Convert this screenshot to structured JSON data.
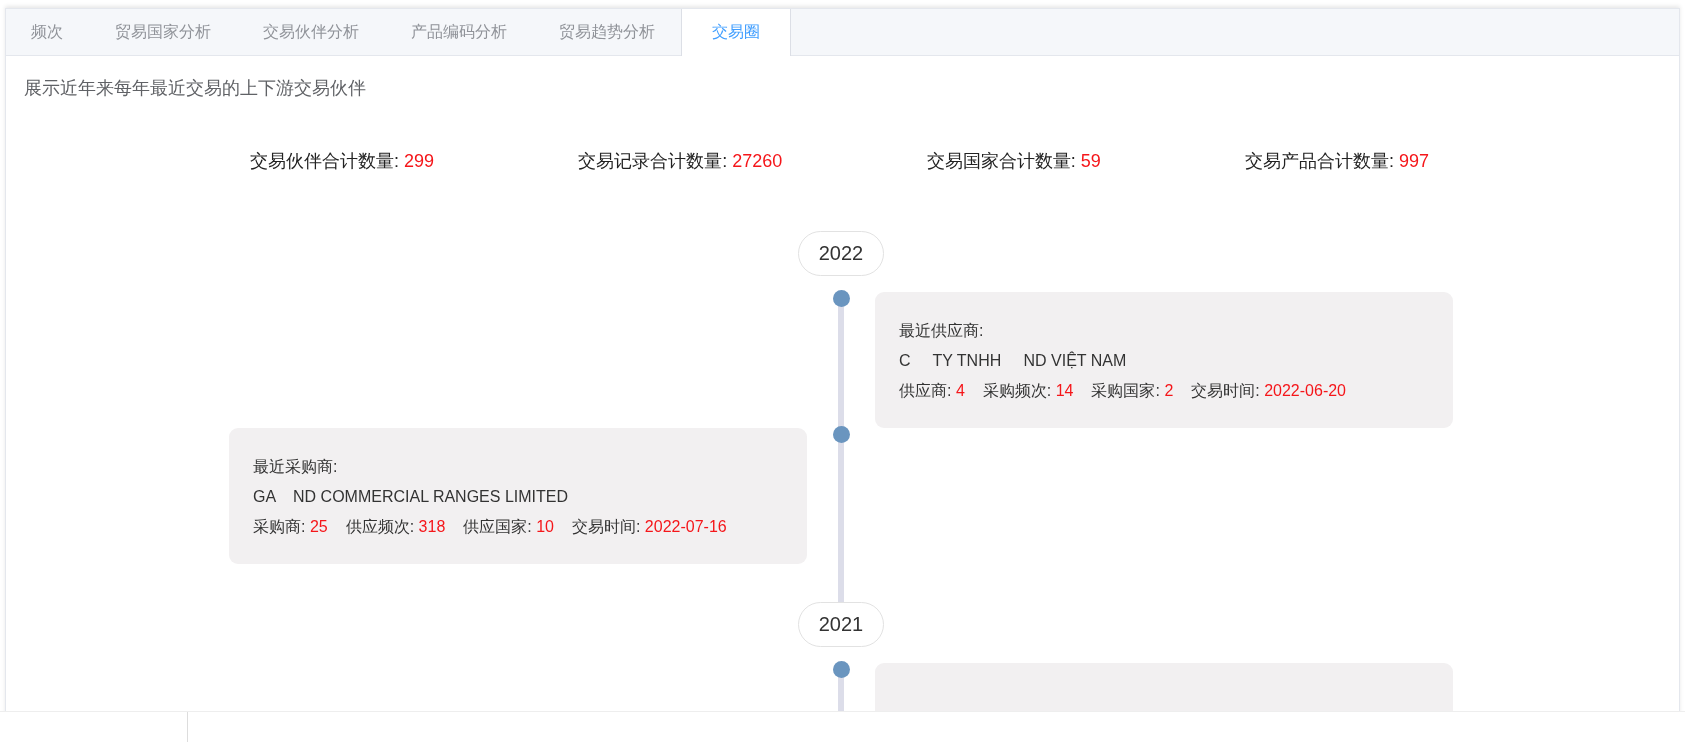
{
  "tabs": [
    {
      "label": "频次",
      "selected": false
    },
    {
      "label": "贸易国家分析",
      "selected": false
    },
    {
      "label": "交易伙伴分析",
      "selected": false
    },
    {
      "label": "产品编码分析",
      "selected": false
    },
    {
      "label": "贸易趋势分析",
      "selected": false
    },
    {
      "label": "交易圈",
      "selected": true
    }
  ],
  "description": "展示近年来每年最近交易的上下游交易伙伴",
  "summary": [
    {
      "label": "交易伙伴合计数量:",
      "value": "299"
    },
    {
      "label": "交易记录合计数量:",
      "value": "27260"
    },
    {
      "label": "交易国家合计数量:",
      "value": "59"
    },
    {
      "label": "交易产品合计数量:",
      "value": "997"
    }
  ],
  "timeline": [
    {
      "year": "2022",
      "entries": [
        {
          "kind": "supplier",
          "title": "最近供应商:",
          "name": "C     TY TNHH     ND VIỆT NAM",
          "stats": [
            {
              "label": "供应商:",
              "value": "4"
            },
            {
              "label": "采购频次:",
              "value": "14"
            },
            {
              "label": "采购国家:",
              "value": "2"
            },
            {
              "label": "交易时间:",
              "value": "2022-06-20"
            }
          ]
        },
        {
          "kind": "buyer",
          "title": "最近采购商:",
          "name": "GA    ND COMMERCIAL RANGES LIMITED",
          "stats": [
            {
              "label": "采购商:",
              "value": "25"
            },
            {
              "label": "供应频次:",
              "value": "318"
            },
            {
              "label": "供应国家:",
              "value": "10"
            },
            {
              "label": "交易时间:",
              "value": "2022-07-16"
            }
          ]
        }
      ]
    },
    {
      "year": "2021",
      "entries": [
        {
          "kind": "supplier"
        }
      ]
    }
  ]
}
